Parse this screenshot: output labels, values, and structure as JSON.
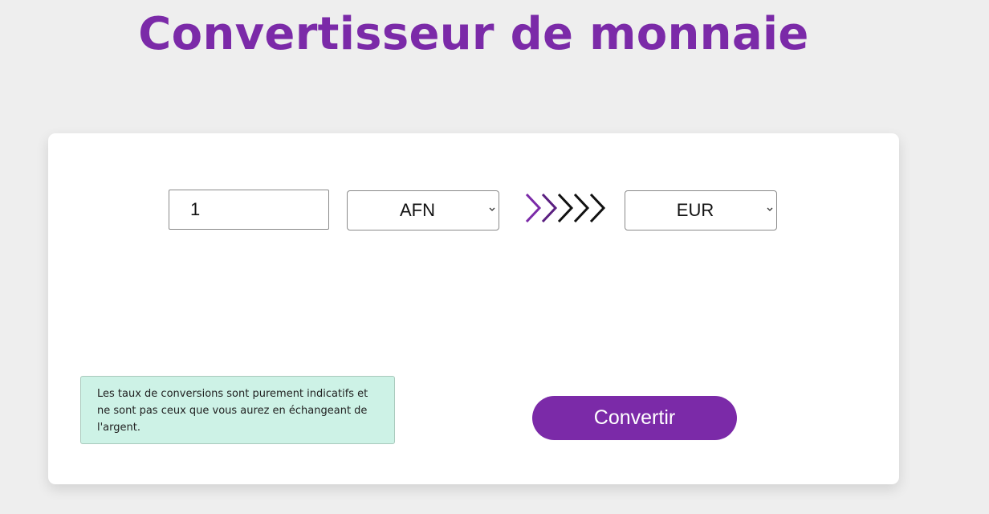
{
  "page": {
    "title": "Convertisseur de monnaie"
  },
  "converter": {
    "amount_value": "1",
    "from_currency": "AFN",
    "to_currency": "EUR",
    "convert_label": "Convertir"
  },
  "note": {
    "text": "Les taux de conversions sont purement indicatifs et ne sont pas ceux que vous aurez en échangeant de l'argent."
  },
  "icons": {
    "direction": "chevrons-right-icon",
    "dropdown": "chevron-down-icon"
  },
  "colors": {
    "accent": "#7b2aa8",
    "accent_dark": "#5a1f80",
    "note_background": "#cdf2e6",
    "page_background": "#eeeeee"
  }
}
